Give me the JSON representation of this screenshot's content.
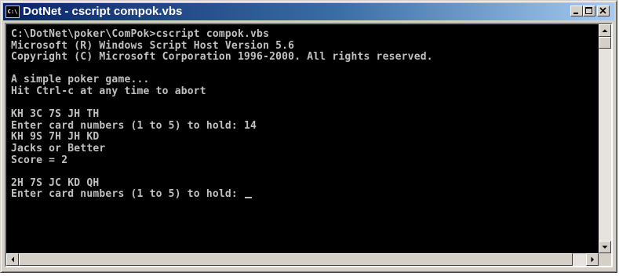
{
  "window": {
    "title": "DotNet - cscript compok.vbs",
    "icon": "console-icon",
    "icon_text": "C:\\",
    "controls": [
      "minimize-icon",
      "maximize-icon",
      "close-icon"
    ]
  },
  "console": {
    "lines": [
      "C:\\DotNet\\poker\\ComPok>cscript compok.vbs",
      "Microsoft (R) Windows Script Host Version 5.6",
      "Copyright (C) Microsoft Corporation 1996-2000. All rights reserved.",
      "",
      "A simple poker game...",
      "Hit Ctrl-c at any time to abort",
      "",
      "KH 3C 7S JH TH",
      "Enter card numbers (1 to 5) to hold: 14",
      "KH 9S 7H JH KD",
      "Jacks or Better",
      "Score = 2",
      "",
      "2H 7S JC KD QH",
      "Enter card numbers (1 to 5) to hold: "
    ]
  },
  "colors": {
    "console_background": "#000000",
    "console_text": "#c0c0c0",
    "titlebar_start": "#0a246a",
    "titlebar_end": "#a6caf0"
  }
}
